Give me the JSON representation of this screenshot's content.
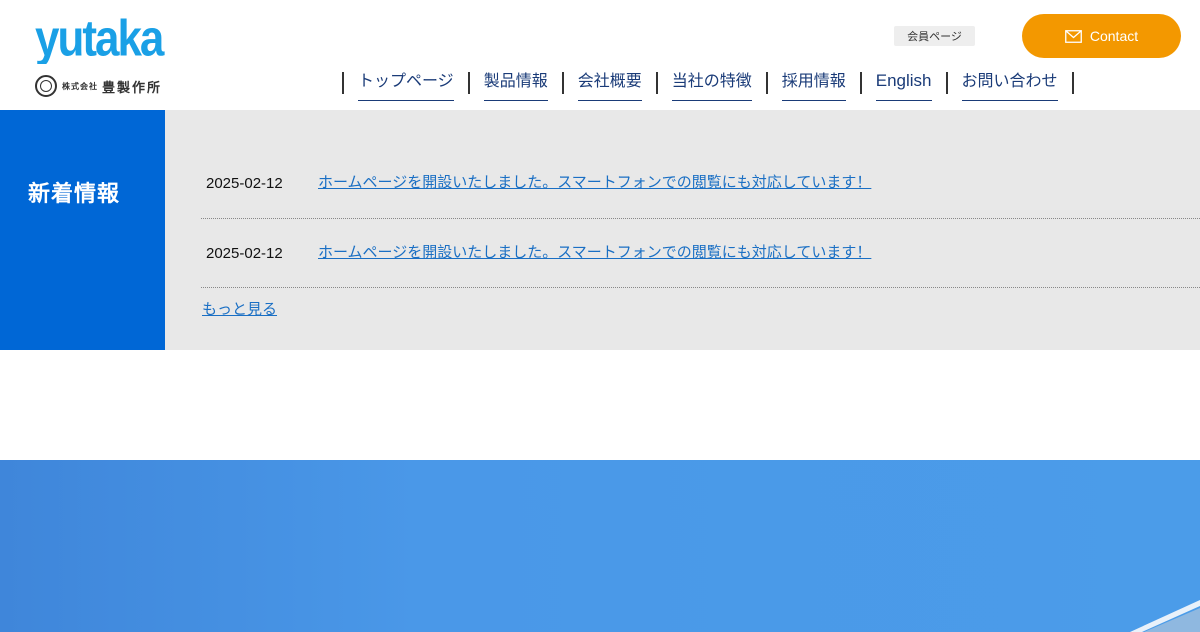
{
  "brand": {
    "logo_text": "yutaka",
    "company_prefix": "株式会社",
    "company_name": "豊製作所",
    "color": "#1aa0e6"
  },
  "header": {
    "member_link": "会員ページ",
    "contact_label": "Contact",
    "contact_color": "#f39800",
    "contact_icon": "mail-icon"
  },
  "nav": {
    "items": [
      {
        "label": "トップページ"
      },
      {
        "label": "製品情報"
      },
      {
        "label": "会社概要"
      },
      {
        "label": "当社の特徴"
      },
      {
        "label": "採用情報"
      },
      {
        "label": "English"
      },
      {
        "label": "お問い合わせ"
      }
    ]
  },
  "news": {
    "heading": "新着情報",
    "heading_bg": "#0067d6",
    "items": [
      {
        "date": "2025-02-12",
        "title": "ホームページを開設いたしました。スマートフォンでの閲覧にも対応しています！"
      },
      {
        "date": "2025-02-12",
        "title": "ホームページを開設いたしました。スマートフォンでの閲覧にも対応しています！"
      }
    ],
    "more": "もっと見る"
  }
}
